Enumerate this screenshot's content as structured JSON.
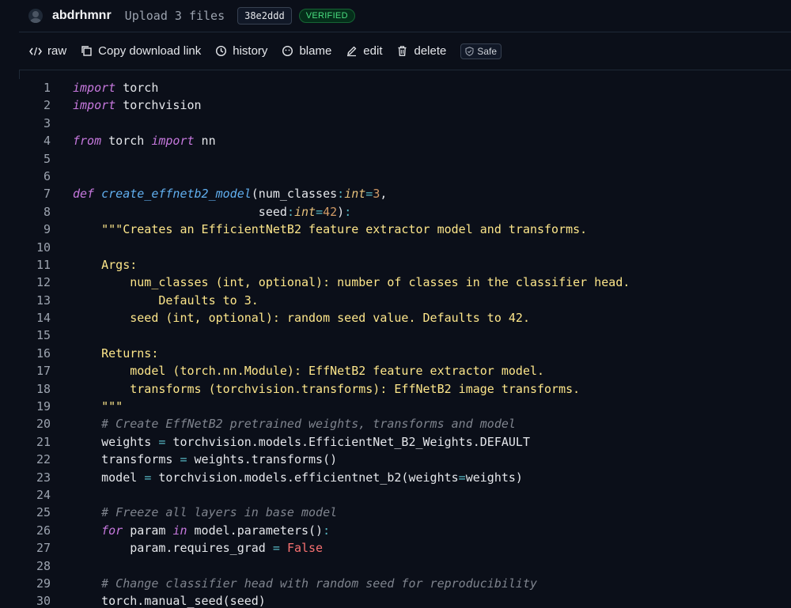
{
  "commit": {
    "author": "abdrhmnr",
    "message": "Upload 3 files",
    "hash": "38e2ddd",
    "badge": "VERIFIED"
  },
  "toolbar": {
    "raw": "raw",
    "copy": "Copy download link",
    "history": "history",
    "blame": "blame",
    "edit": "edit",
    "delete": "delete",
    "safe": "Safe"
  },
  "code": {
    "language": "python",
    "lines": [
      "import torch",
      "import torchvision",
      "",
      "from torch import nn",
      "",
      "",
      "def create_effnetb2_model(num_classes:int=3,",
      "                          seed:int=42):",
      "    \"\"\"Creates an EfficientNetB2 feature extractor model and transforms.",
      "",
      "    Args:",
      "        num_classes (int, optional): number of classes in the classifier head.",
      "            Defaults to 3.",
      "        seed (int, optional): random seed value. Defaults to 42.",
      "",
      "    Returns:",
      "        model (torch.nn.Module): EffNetB2 feature extractor model.",
      "        transforms (torchvision.transforms): EffNetB2 image transforms.",
      "    \"\"\"",
      "    # Create EffNetB2 pretrained weights, transforms and model",
      "    weights = torchvision.models.EfficientNet_B2_Weights.DEFAULT",
      "    transforms = weights.transforms()",
      "    model = torchvision.models.efficientnet_b2(weights=weights)",
      "",
      "    # Freeze all layers in base model",
      "    for param in model.parameters():",
      "        param.requires_grad = False",
      "",
      "    # Change classifier head with random seed for reproducibility",
      "    torch.manual_seed(seed)"
    ]
  }
}
